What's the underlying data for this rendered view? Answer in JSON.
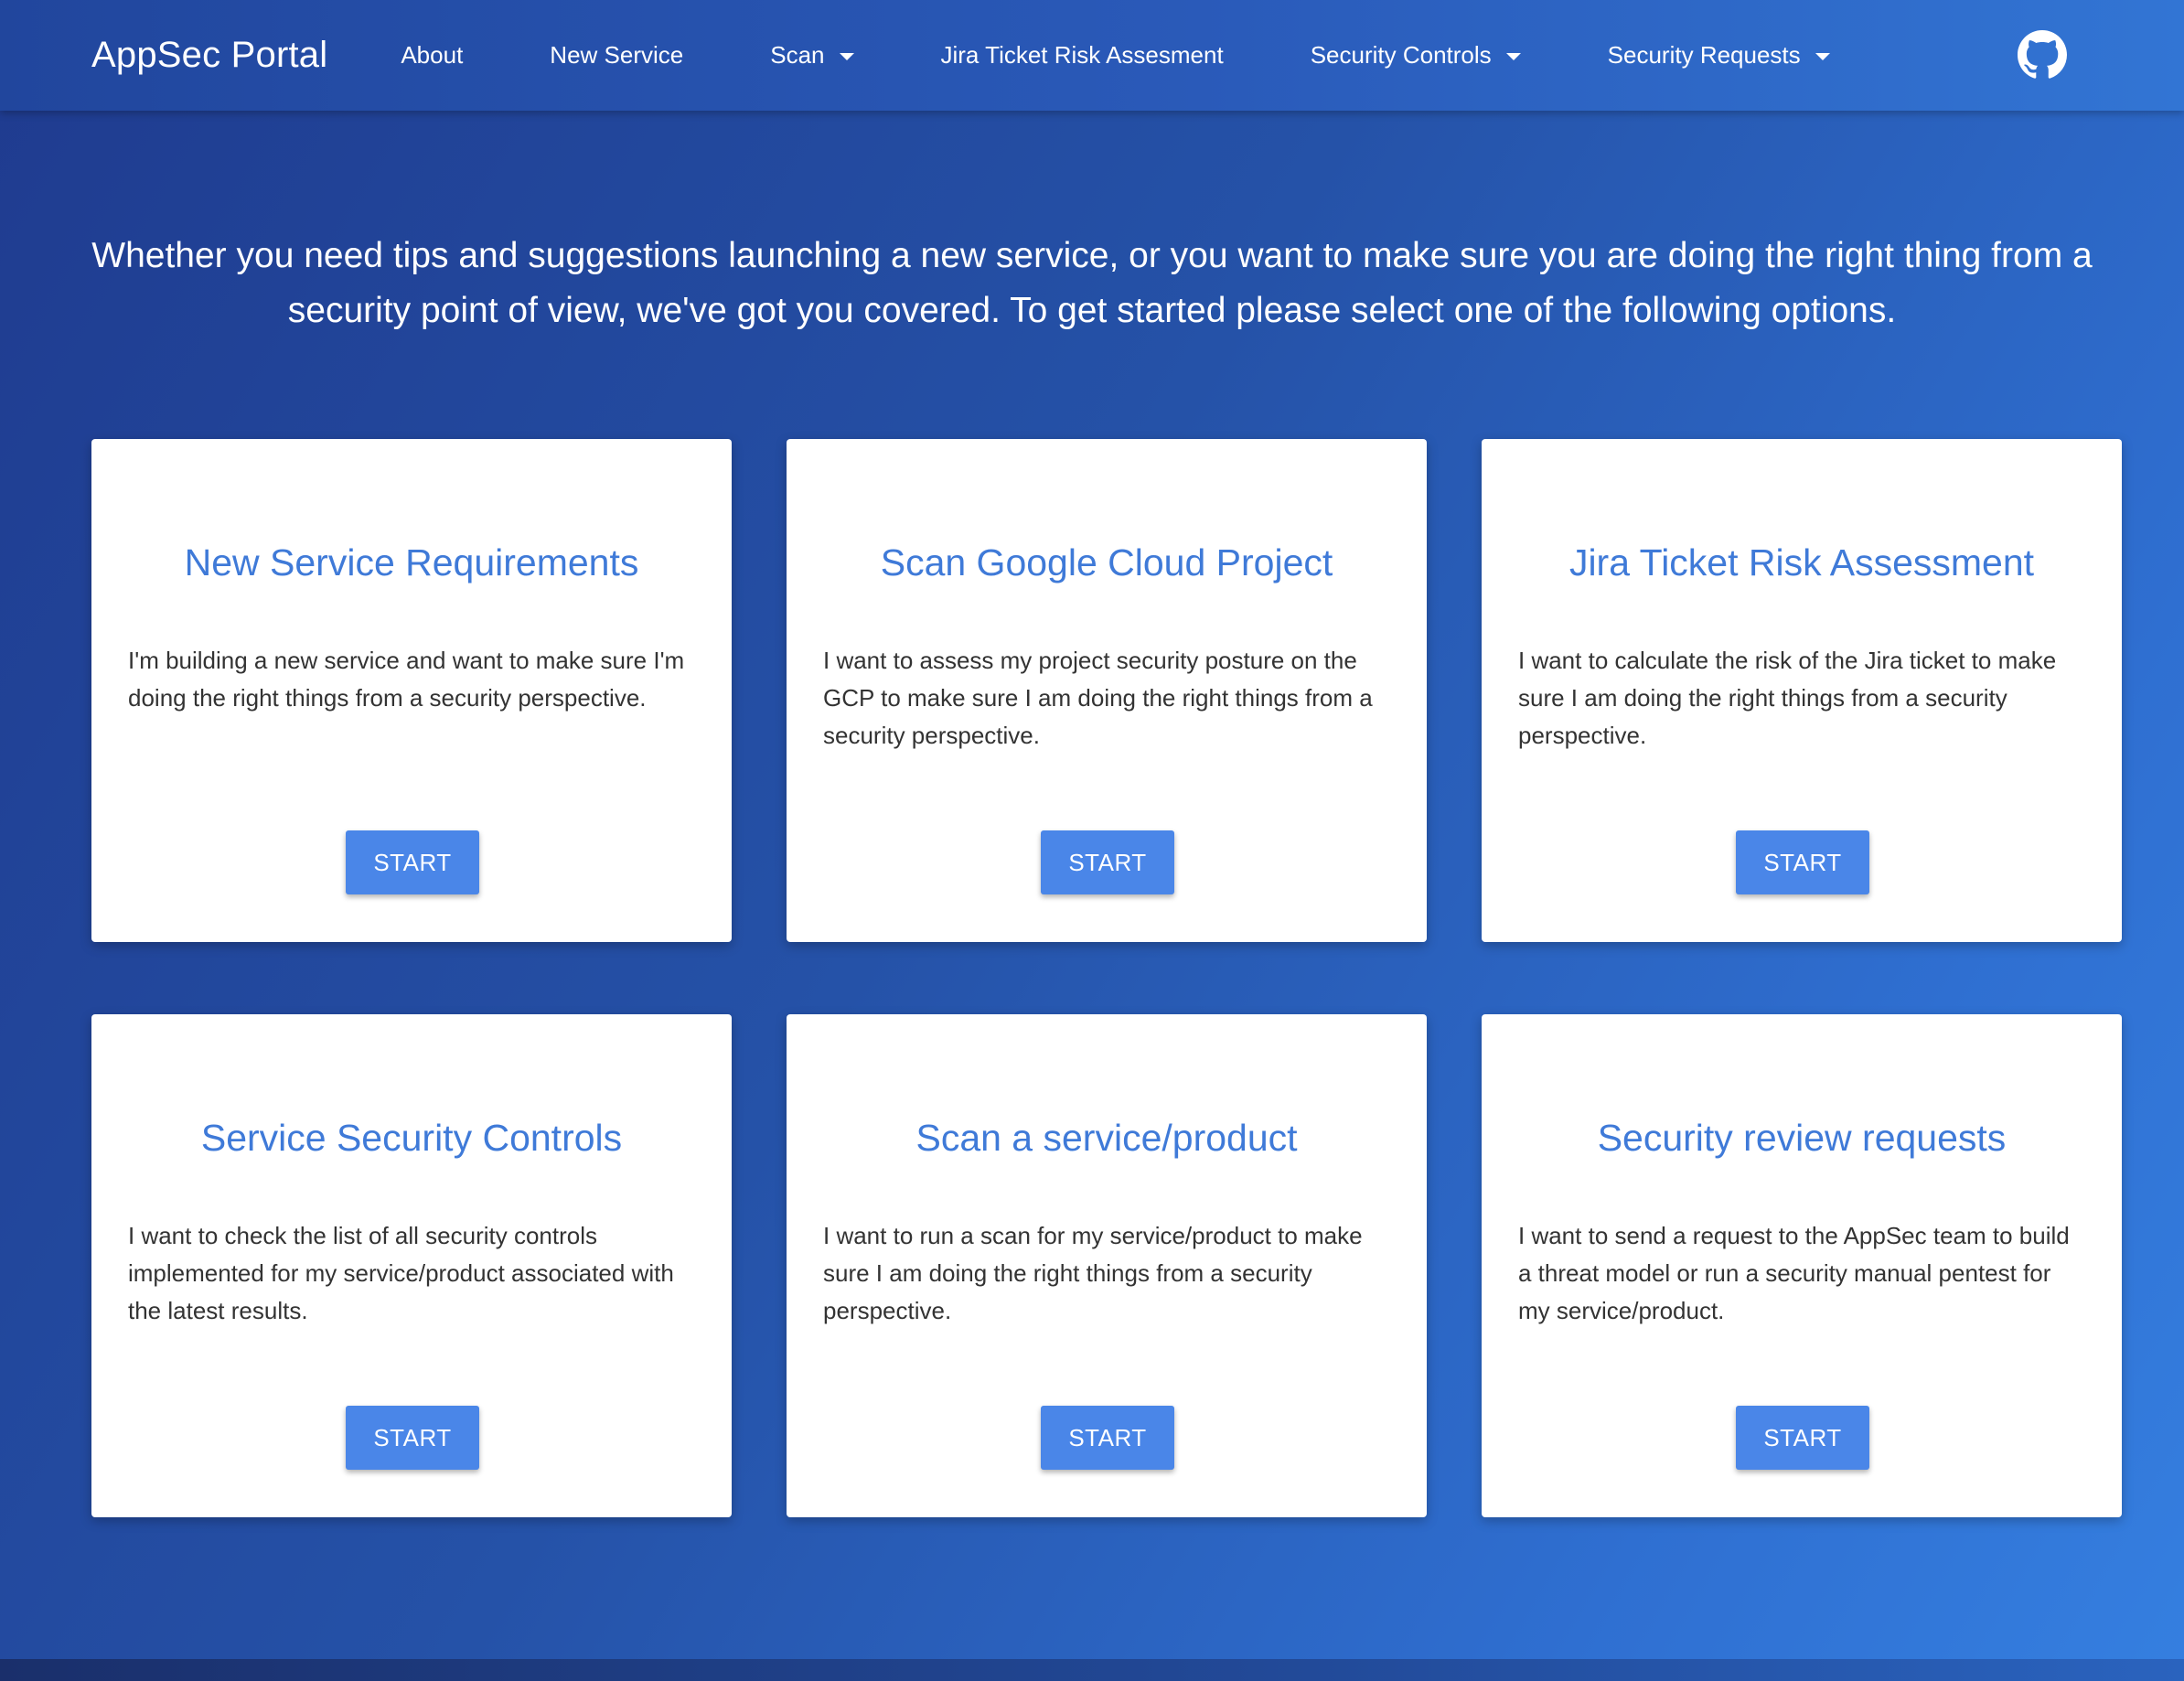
{
  "navbar": {
    "brand_bold": "AppSec",
    "brand_rest": "Portal",
    "items": [
      {
        "label": "About",
        "dropdown": false
      },
      {
        "label": "New Service",
        "dropdown": false
      },
      {
        "label": "Scan",
        "dropdown": true
      },
      {
        "label": "Jira Ticket Risk Assesment",
        "dropdown": false
      },
      {
        "label": "Security Controls",
        "dropdown": true
      },
      {
        "label": "Security Requests",
        "dropdown": true
      }
    ],
    "github_icon": "github-icon"
  },
  "hero": {
    "text": "Whether you need tips and suggestions launching a new service, or you want to make sure you are doing the right thing from a security point of view, we've got you covered. To get started please select one of the following options."
  },
  "cards": [
    {
      "title": "New Service Requirements",
      "text": "I'm building a new service and want to make sure I'm doing the right things from a security perspective.",
      "button": "START"
    },
    {
      "title": "Scan Google Cloud Project",
      "text": "I want to assess my project security posture on the GCP to make sure I am doing the right things from a security perspective.",
      "button": "START"
    },
    {
      "title": "Jira Ticket Risk Assessment",
      "text": "I want to calculate the risk of the Jira ticket to make sure I am doing the right things from a security perspective.",
      "button": "START"
    },
    {
      "title": "Service Security Controls",
      "text": "I want to check the list of all security controls implemented for my service/product associated with the latest results.",
      "button": "START"
    },
    {
      "title": "Scan a service/product",
      "text": "I want to run a scan for my service/product to make sure I am doing the right things from a security perspective.",
      "button": "START"
    },
    {
      "title": "Security review requests",
      "text": "I want to send a request to the AppSec team to build a threat model or run a security manual pentest for my service/product.",
      "button": "START"
    }
  ],
  "colors": {
    "accent": "#4a86e8",
    "title": "#3f7ad8",
    "background_start": "#1f3b8f",
    "background_end": "#357fe0"
  }
}
